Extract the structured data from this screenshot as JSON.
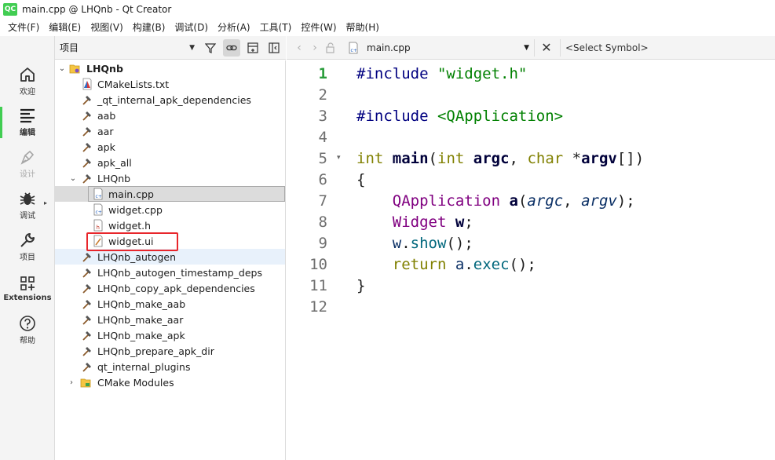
{
  "window": {
    "app_icon_text": "QC",
    "title": "main.cpp @ LHQnb - Qt Creator"
  },
  "menu": [
    "文件(F)",
    "编辑(E)",
    "视图(V)",
    "构建(B)",
    "调试(D)",
    "分析(A)",
    "工具(T)",
    "控件(W)",
    "帮助(H)"
  ],
  "modes": [
    {
      "label": "欢迎",
      "icon": "home-icon"
    },
    {
      "label": "编辑",
      "icon": "edit-icon"
    },
    {
      "label": "设计",
      "icon": "design-pen-icon"
    },
    {
      "label": "调试",
      "icon": "debug-bug-icon"
    },
    {
      "label": "项目",
      "icon": "wrench-icon"
    },
    {
      "label": "Extensions",
      "icon": "extensions-icon"
    },
    {
      "label": "帮助",
      "icon": "help-icon"
    }
  ],
  "project_pane": {
    "view_label": "项目",
    "tree": [
      {
        "label": "LHQnb",
        "icon": "qt-project-folder-icon",
        "expanded": true
      },
      {
        "label": "CMakeLists.txt",
        "icon": "cmake-file-icon"
      },
      {
        "label": "_qt_internal_apk_dependencies",
        "icon": "hammer-icon"
      },
      {
        "label": "aab",
        "icon": "hammer-icon"
      },
      {
        "label": "aar",
        "icon": "hammer-icon"
      },
      {
        "label": "apk",
        "icon": "hammer-icon"
      },
      {
        "label": "apk_all",
        "icon": "hammer-icon"
      },
      {
        "label": "LHQnb",
        "icon": "hammer-icon",
        "expanded": true
      },
      {
        "label": "main.cpp",
        "icon": "cpp-file-icon",
        "selected": true
      },
      {
        "label": "widget.cpp",
        "icon": "cpp-file-icon"
      },
      {
        "label": "widget.h",
        "icon": "header-file-icon"
      },
      {
        "label": "widget.ui",
        "icon": "ui-file-icon",
        "highlighted": true
      },
      {
        "label": "LHQnb_autogen",
        "icon": "hammer-icon"
      },
      {
        "label": "LHQnb_autogen_timestamp_deps",
        "icon": "hammer-icon"
      },
      {
        "label": "LHQnb_copy_apk_dependencies",
        "icon": "hammer-icon"
      },
      {
        "label": "LHQnb_make_aab",
        "icon": "hammer-icon"
      },
      {
        "label": "LHQnb_make_aar",
        "icon": "hammer-icon"
      },
      {
        "label": "LHQnb_make_apk",
        "icon": "hammer-icon"
      },
      {
        "label": "LHQnb_prepare_apk_dir",
        "icon": "hammer-icon"
      },
      {
        "label": "qt_internal_plugins",
        "icon": "hammer-icon"
      },
      {
        "label": "CMake Modules",
        "icon": "cmake-modules-folder-icon",
        "expanded": false
      }
    ]
  },
  "editor": {
    "file_name": "main.cpp",
    "symbol_placeholder": "<Select Symbol>",
    "current_line": 1,
    "line_numbers": [
      "1",
      "2",
      "3",
      "4",
      "5",
      "6",
      "7",
      "8",
      "9",
      "10",
      "11",
      "12"
    ],
    "code": {
      "l1_kw": "#include",
      "l1_str": " \"widget.h\"",
      "l3_kw": "#include",
      "l3_str": " <QApplication>",
      "l5_type": "int",
      "l5_fn": "main",
      "l5_open": "(",
      "l5_t1": "int",
      "l5_a1": "argc",
      "l5_comma": ", ",
      "l5_t2": "char",
      "l5_star": " *",
      "l5_a2": "argv",
      "l5_close": "[])",
      "l6": "{",
      "l7_type": "QApplication",
      "l7_var": "a",
      "l7_open": "(",
      "l7_a1": "argc",
      "l7_comma": ", ",
      "l7_a2": "argv",
      "l7_close": ");",
      "l8_type": "Widget",
      "l8_var": "w",
      "l8_end": ";",
      "l9_obj": "w",
      "l9_dot": ".",
      "l9_fn": "show",
      "l9_end": "();",
      "l10_kw": "return",
      "l10_obj": "a",
      "l10_dot": ".",
      "l10_fn": "exec",
      "l10_end": "();",
      "l11": "}"
    }
  },
  "colors": {
    "accent": "#41cd52",
    "highlight_box": "#e8262b",
    "selection": "#dcdcdc"
  }
}
